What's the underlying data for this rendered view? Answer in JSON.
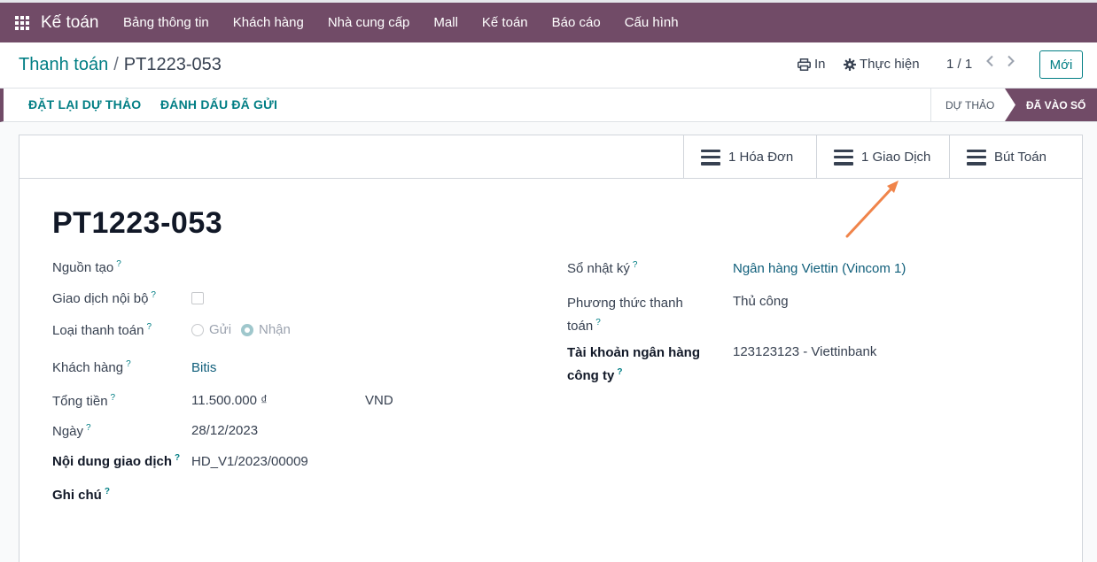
{
  "topnav": {
    "brand": "Kế toán",
    "menu": [
      "Bảng thông tin",
      "Khách hàng",
      "Nhà cung cấp",
      "Mall",
      "Kế toán",
      "Báo cáo",
      "Cấu hình"
    ]
  },
  "control": {
    "breadcrumb_parent": "Thanh toán",
    "breadcrumb_sep": "/",
    "breadcrumb_current": "PT1223-053",
    "print_label": "In",
    "action_label": "Thực hiện",
    "pager": "1 / 1",
    "new_label": "Mới"
  },
  "status": {
    "reset_draft": "ĐẶT LẠI DỰ THẢO",
    "mark_sent": "ĐÁNH DẤU ĐÃ GỬI",
    "stage_draft": "DỰ THẢO",
    "stage_posted": "ĐÃ VÀO SỔ"
  },
  "smart_buttons": {
    "invoices": "1 Hóa Đơn",
    "transactions": "1 Giao Dịch",
    "journal_items": "Bút Toán"
  },
  "record": {
    "title": "PT1223-053",
    "tooltip_mark": "?",
    "left": {
      "source_label": "Nguồn tạo",
      "internal_label": "Giao dịch nội bộ",
      "payment_type_label": "Loại thanh toán",
      "send_label": "Gửi",
      "receive_label": "Nhận",
      "customer_label": "Khách hàng",
      "customer_value": "Bitis",
      "amount_label": "Tổng tiền",
      "amount_value": "11.500.000 ₫",
      "currency_value": "VND",
      "date_label": "Ngày",
      "date_value": "28/12/2023",
      "memo_label": "Nội dung giao dịch",
      "memo_value": "HD_V1/2023/00009",
      "note_label": "Ghi chú"
    },
    "right": {
      "journal_label": "Sổ nhật ký",
      "journal_value": "Ngân hàng Viettin (Vincom 1)",
      "method_label_line1": "Phương thức thanh",
      "method_label_line2": "toán",
      "method_value": "Thủ công",
      "bank_label_line1": "Tài khoản ngân hàng",
      "bank_label_line2": "công ty",
      "bank_value": "123123123 - Viettinbank"
    }
  },
  "colors": {
    "brand": "#714b67",
    "accent": "#017e84",
    "annotation_arrow": "#f0844a"
  }
}
